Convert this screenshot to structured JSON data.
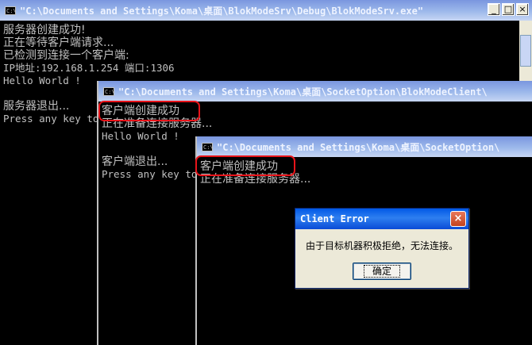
{
  "server_window": {
    "title": "\"C:\\Documents and Settings\\Koma\\桌面\\BlokModeSrv\\Debug\\BlokModeSrv.exe\"",
    "icon": "cmd-icon",
    "buttons": {
      "minimize": "_",
      "maximize": "□",
      "close": "×"
    },
    "lines": [
      "服务器创建成功!",
      "正在等待客户端请求...",
      "已检测到连接一个客户端:",
      "IP地址:192.168.1.254 端口:1306",
      "Hello World !",
      "",
      "服务器退出...",
      "Press any key to continue"
    ]
  },
  "client_window_1": {
    "title": "\"C:\\Documents and Settings\\Koma\\桌面\\SocketOption\\BlokModeClient\\",
    "icon": "cmd-icon",
    "lines": [
      "客户端创建成功",
      "正在准备连接服务器...",
      "Hello World !",
      "",
      "客户端退出...",
      "Press any key to continue"
    ]
  },
  "client_window_2": {
    "title": "\"C:\\Documents and Settings\\Koma\\桌面\\SocketOption\\",
    "icon": "cmd-icon",
    "lines": [
      "客户端创建成功",
      "正在准备连接服务器..."
    ]
  },
  "dialog": {
    "title": "Client Error",
    "close": "×",
    "message": "由于目标机器积极拒绝，无法连接。",
    "ok_label": "确定"
  },
  "colors": {
    "highlight": "#e8141a",
    "console_bg": "#000000",
    "console_text": "#c0c0c0"
  }
}
